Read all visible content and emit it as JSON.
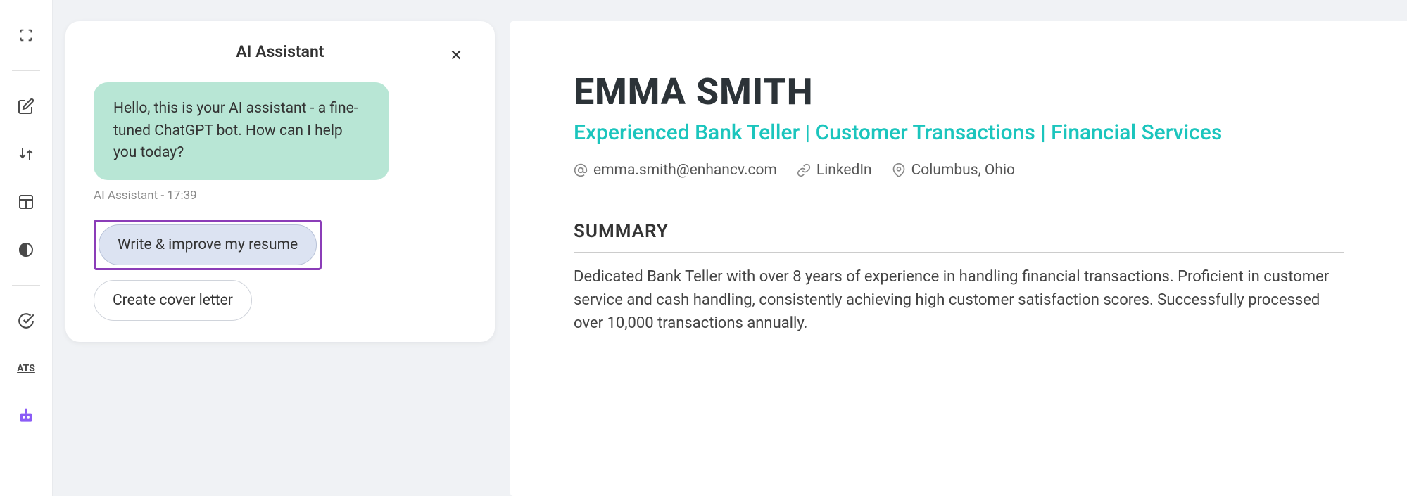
{
  "sidebar": {
    "icons": [
      "fullscreen",
      "edit",
      "sort",
      "layout",
      "contrast",
      "check",
      "ats",
      "bot"
    ]
  },
  "chat": {
    "title": "AI Assistant",
    "bubble": "Hello, this is your AI assistant - a fine-tuned ChatGPT bot. How can I help you today?",
    "meta": "AI Assistant - 17:39",
    "actions": {
      "write_resume": "Write & improve my resume",
      "cover_letter": "Create cover letter"
    }
  },
  "resume": {
    "name": "EMMA SMITH",
    "tagline": "Experienced Bank Teller | Customer Transactions | Financial Services",
    "contact": {
      "email": "emma.smith@enhancv.com",
      "linkedin": "LinkedIn",
      "location": "Columbus, Ohio"
    },
    "summary_title": "SUMMARY",
    "summary_text": "Dedicated Bank Teller with over 8 years of experience in handling financial transactions. Proficient in customer service and cash handling, consistently achieving high customer satisfaction scores. Successfully processed over 10,000 transactions annually."
  },
  "ats_label": "ATS"
}
